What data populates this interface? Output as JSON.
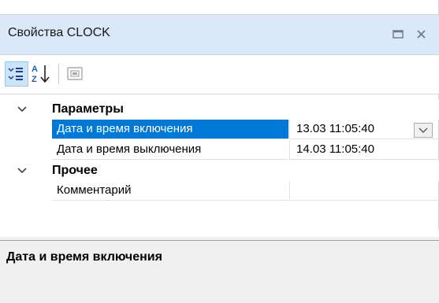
{
  "window": {
    "title": "Свойства CLOCK",
    "restore_icon": "window-restore-icon",
    "close_icon": "close-icon"
  },
  "toolbar": {
    "categorized_icon": "categorized-icon",
    "alphabetical_icon": "sort-alphabetical-icon",
    "property_pages_icon": "property-pages-icon",
    "categorized_active": true
  },
  "grid": {
    "categories": [
      {
        "label": "Параметры",
        "expanded": true,
        "properties": [
          {
            "name": "Дата и время включения",
            "value": "13.03 11:05:40",
            "selected": true
          },
          {
            "name": "Дата и время выключения",
            "value": "14.03 11:05:40",
            "selected": false
          }
        ]
      },
      {
        "label": "Прочее",
        "expanded": true,
        "properties": [
          {
            "name": "Комментарий",
            "value": "",
            "selected": false
          }
        ]
      }
    ]
  },
  "description": {
    "title": "Дата и время включения"
  },
  "colors": {
    "titlebar_bg": "#dbe8f7",
    "selection": "#0078d7",
    "description_bg": "#f0f0f0"
  }
}
